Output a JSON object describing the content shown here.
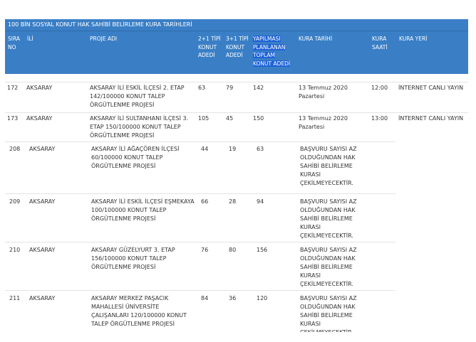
{
  "table": {
    "title": "100 BİN SOSYAL KONUT HAK SAHİBİ BELİRLEME KURA TARİHLERİ",
    "headers": {
      "sira_no": "SIRA\nNO",
      "ili": "İLİ",
      "proje_adi": "PROJE ADI",
      "tip_2_1": "2+1 TİPİ\nKONUT\nADEDİ",
      "tip_3_1": "3+1 TİPİ\nKONUT\nADEDİ",
      "toplam": "YAPILMASI\nPLANLANAN\nTOPLAM\nKONUT ADEDİ",
      "kura_tarihi": "KURA TARİHİ",
      "kura_saati": "KURA\nSAATİ",
      "kura_yeri": "KURA YERİ"
    },
    "rows": [
      {
        "no": "172",
        "il": "AKSARAY",
        "proje": "AKSARAY İLİ ESKİL İLÇESİ 2. ETAP\n142/100000 KONUT TALEP\nÖRGÜTLENME PROJESİ",
        "t21": "63",
        "t31": "79",
        "toplam": "142",
        "tarih": "13 Temmuz 2020\nPazartesi",
        "saat": "12:00",
        "yer": "İNTERNET CANLI YAYIN"
      },
      {
        "no": "173",
        "il": "AKSARAY",
        "proje": "AKSARAY İLİ SULTANHANI İLÇESİ 3.\nETAP 150/100000 KONUT TALEP\nÖRGÜTLENME PROJESİ",
        "t21": "105",
        "t31": "45",
        "toplam": "150",
        "tarih": "13 Temmuz 2020\nPazartesi",
        "saat": "13:00",
        "yer": "İNTERNET CANLI YAYIN"
      },
      {
        "no": "208",
        "il": "AKSARAY",
        "proje": "AKSARAY İLİ AĞAÇÖREN İLÇESİ\n60/100000 KONUT TALEP\nÖRGÜTLENME PROJESİ",
        "t21": "44",
        "t31": "19",
        "toplam": "63",
        "tarih": "BAŞVURU SAYISI AZ\nOLDUĞUNDAN HAK\nSAHİBİ BELİRLEME\nKURASI\nÇEKİLMEYECEKTİR.",
        "saat": "",
        "yer": ""
      },
      {
        "no": "209",
        "il": "AKSARAY",
        "proje": "AKSARAY İLİ ESKİL İLÇESİ EŞMEKAYA\n100/100000 KONUT TALEP\nÖRGÜTLENME PROJESİ",
        "t21": "66",
        "t31": "28",
        "toplam": "94",
        "tarih": "BAŞVURU SAYISI AZ\nOLDUĞUNDAN HAK\nSAHİBİ BELİRLEME\nKURASI\nÇEKİLMEYECEKTİR.",
        "saat": "",
        "yer": ""
      },
      {
        "no": "210",
        "il": "AKSARAY",
        "proje": "AKSARAY GÜZELYURT 3. ETAP\n156/100000 KONUT TALEP\nÖRGÜTLENME PROJESİ",
        "t21": "76",
        "t31": "80",
        "toplam": "156",
        "tarih": "BAŞVURU SAYISI AZ\nOLDUĞUNDAN HAK\nSAHİBİ BELİRLEME\nKURASI\nÇEKİLMEYECEKTİR.",
        "saat": "",
        "yer": ""
      },
      {
        "no": "211",
        "il": "AKSARAY",
        "proje": "AKSARAY MERKEZ PAŞACIK\nMAHALLESİ ÜNİVERSİTE\nÇALIŞANLARI 120/100000 KONUT\nTALEP ÖRGÜTLENME PROJESİ",
        "t21": "84",
        "t31": "36",
        "toplam": "120",
        "tarih": "BAŞVURU SAYISI AZ\nOLDUĞUNDAN HAK\nSAHİBİ BELİRLEME\nKURASI\nÇEKİLMEYECEKTİR.",
        "saat": "",
        "yer": ""
      }
    ]
  }
}
